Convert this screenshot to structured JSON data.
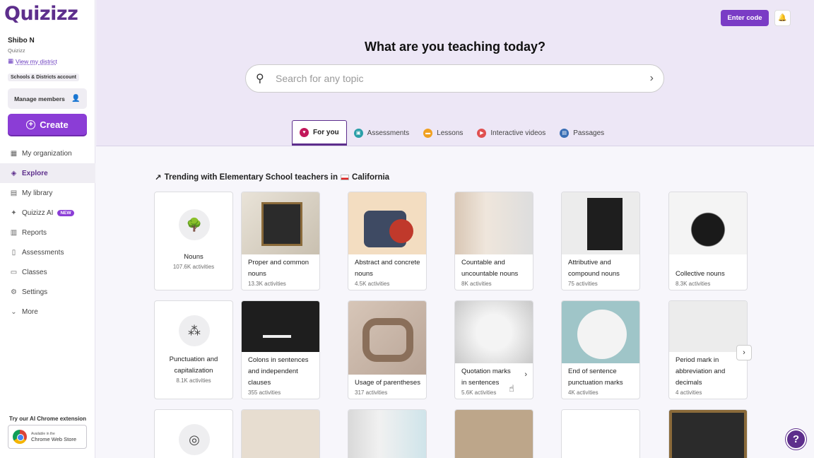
{
  "sidebar": {
    "logo": "Quizizz",
    "user_name": "Shibo N",
    "user_org": "Quizizz",
    "district_link": "View my district",
    "account_badge": "Schools & Districts account",
    "manage_members": "Manage members",
    "create_label": "Create",
    "nav": [
      {
        "label": "My organization",
        "icon": "building-icon"
      },
      {
        "label": "Explore",
        "icon": "explore-icon",
        "active": true
      },
      {
        "label": "My library",
        "icon": "library-icon"
      },
      {
        "label": "Quizizz AI",
        "icon": "sparkle-icon",
        "badge": "NEW"
      },
      {
        "label": "Reports",
        "icon": "reports-icon"
      },
      {
        "label": "Assessments",
        "icon": "clipboard-icon"
      },
      {
        "label": "Classes",
        "icon": "classes-icon"
      },
      {
        "label": "Settings",
        "icon": "gear-icon"
      },
      {
        "label": "More",
        "icon": "chevron-down-icon"
      }
    ],
    "extension_title": "Try our AI Chrome extension",
    "store_small": "Available in the",
    "store_big": "Chrome Web Store"
  },
  "header": {
    "enter_code": "Enter code",
    "title": "What are you teaching today?",
    "search_placeholder": "Search for any topic",
    "tabs": [
      {
        "label": "For you",
        "color": "#c2185b",
        "active": true
      },
      {
        "label": "Assessments",
        "color": "#2a9fa8"
      },
      {
        "label": "Lessons",
        "color": "#f0a020"
      },
      {
        "label": "Interactive videos",
        "color": "#e05050"
      },
      {
        "label": "Passages",
        "color": "#3a6fb5"
      }
    ]
  },
  "trending": {
    "prefix": "Trending with Elementary School teachers in",
    "place": "California",
    "rows": [
      [
        {
          "title": "Nouns",
          "count": "107.6K activities",
          "style": "center"
        },
        {
          "title": "Proper and common nouns",
          "count": "13.3K activities"
        },
        {
          "title": "Abstract and concrete nouns",
          "count": "4.5K activities"
        },
        {
          "title": "Countable and uncountable nouns",
          "count": "8K activities"
        },
        {
          "title": "Attributive and compound nouns",
          "count": "75 activities"
        },
        {
          "title": "Collective nouns",
          "count": "8.3K activities"
        }
      ],
      [
        {
          "title": "Punctuation and capitalization",
          "count": "8.1K activities",
          "style": "center"
        },
        {
          "title": "Colons in sentences and independent clauses",
          "count": "355 activities"
        },
        {
          "title": "Usage of parentheses",
          "count": "317 activities"
        },
        {
          "title": "Quotation marks in sentences",
          "count": "5.6K activities"
        },
        {
          "title": "End of sentence punctuation marks",
          "count": "4K activities"
        },
        {
          "title": "Period mark in abbreviation and decimals",
          "count": "4 activities"
        }
      ]
    ]
  }
}
